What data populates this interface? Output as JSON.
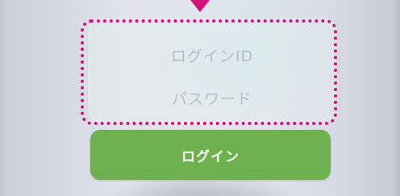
{
  "login_form": {
    "login_id_placeholder": "ログインID",
    "password_placeholder": "パスワード",
    "login_button_label": "ログイン"
  },
  "colors": {
    "highlight": "#d6127a",
    "login_button": "#6eb24f",
    "placeholder_text": "#b6bdc6"
  }
}
